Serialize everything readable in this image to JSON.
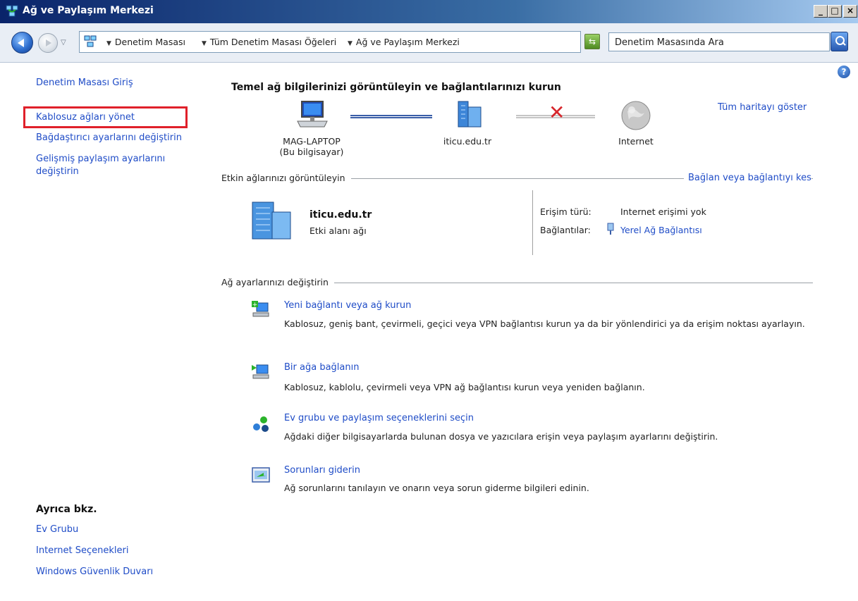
{
  "window": {
    "title": "Ağ ve Paylaşım Merkezi",
    "min": "_",
    "max": "□",
    "close": "×"
  },
  "address": {
    "crumbs": [
      "Denetim Masası",
      "Tüm Denetim Masası Öğeleri",
      "Ağ ve Paylaşım Merkezi"
    ],
    "search_placeholder": "Denetim Masasında Ara"
  },
  "sidebar": {
    "home": "Denetim Masası Giriş",
    "items": [
      "Kablosuz ağları yönet",
      "Bağdaştırıcı ayarlarını değiştirin",
      "Gelişmiş paylaşım ayarlarını",
      "değiştirin"
    ],
    "see_also_title": "Ayrıca bkz.",
    "see_also": [
      "Ev Grubu",
      "Internet Seçenekleri",
      "Windows Güvenlik Duvarı"
    ]
  },
  "main": {
    "heading": "Temel ağ bilgilerinizi görüntüleyin ve bağlantılarınızı kurun",
    "full_map_link": "Tüm haritayı göster",
    "map": {
      "computer_name": "MAG-LAPTOP",
      "computer_sub": "(Bu bilgisayar)",
      "network": "iticu.edu.tr",
      "internet": "Internet"
    },
    "active_networks_title": "Etkin ağlarınızı görüntüleyin",
    "connect_toggle": "Bağlan veya bağlantıyı kes",
    "active_network": {
      "name": "iticu.edu.tr",
      "type": "Etki alanı ağı",
      "access_label": "Erişim türü:",
      "access_value": "Internet erişimi yok",
      "connections_label": "Bağlantılar:",
      "connections_value": "Yerel Ağ Bağlantısı"
    },
    "change_settings_title": "Ağ ayarlarınızı değiştirin",
    "tasks": [
      {
        "title": "Yeni bağlantı veya ağ kurun",
        "desc": "Kablosuz, geniş bant, çevirmeli, geçici veya VPN bağlantısı kurun ya da bir yönlendirici ya da erişim noktası ayarlayın."
      },
      {
        "title": "Bir ağa bağlanın",
        "desc": "Kablosuz, kablolu, çevirmeli veya VPN ağ bağlantısı kurun veya yeniden bağlanın."
      },
      {
        "title": "Ev grubu ve paylaşım seçeneklerini seçin",
        "desc": "Ağdaki diğer bilgisayarlarda bulunan dosya ve yazıcılara erişin veya paylaşım ayarlarını değiştirin."
      },
      {
        "title": "Sorunları giderin",
        "desc": "Ağ sorunlarını tanılayın ve onarın veya sorun giderme bilgileri edinin."
      }
    ]
  },
  "colors": {
    "link": "#1f4cc7",
    "highlight": "#e0202a",
    "titlebar": "#0a246a"
  }
}
